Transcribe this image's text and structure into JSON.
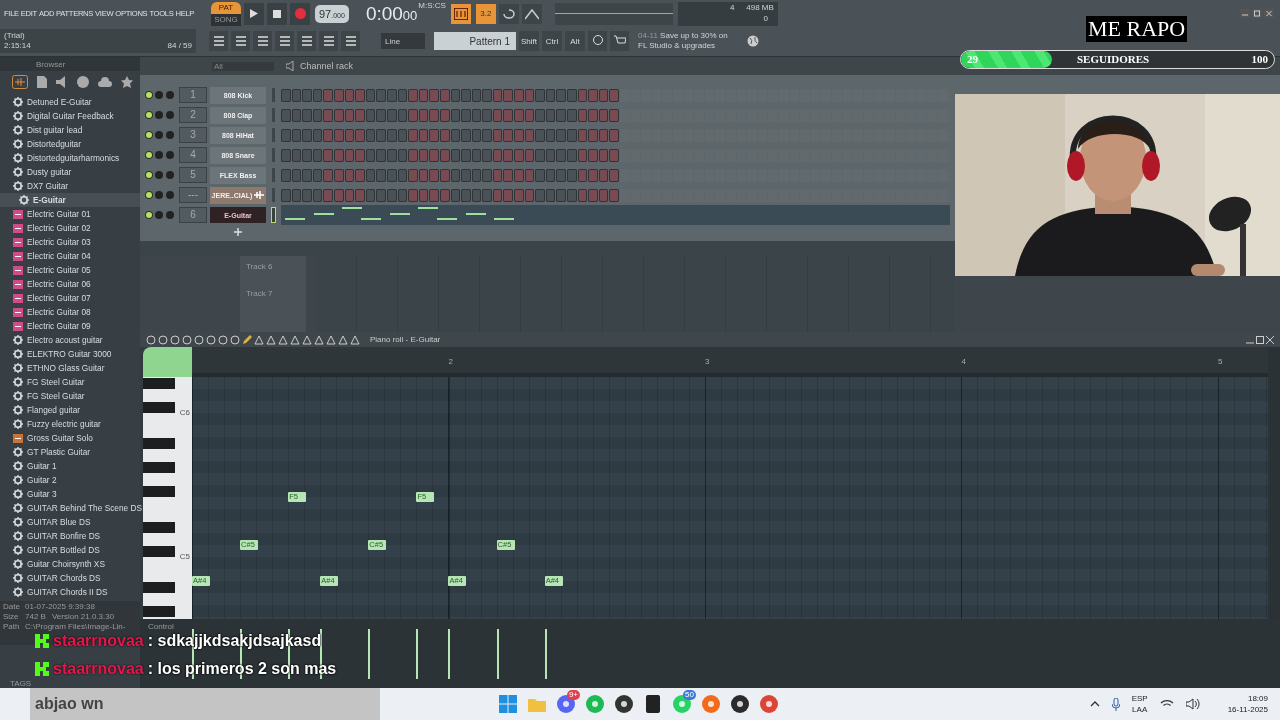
{
  "menu": [
    "FILE",
    "EDIT",
    "ADD",
    "PATTERNS",
    "VIEW",
    "OPTIONS",
    "TOOLS",
    "HELP"
  ],
  "transport": {
    "modes": [
      {
        "label": "PAT",
        "selected": true
      },
      {
        "label": "SONG",
        "selected": false
      }
    ],
    "recording": true,
    "tempo": "97",
    "tempo_fraction": ".000",
    "time": "0:00",
    "time_small": "00",
    "time_unit": "M:S:CS",
    "cpu": "4",
    "memory": "498 MB",
    "voices": "0",
    "toggles": [
      {
        "label": "3.2",
        "on": true
      }
    ]
  },
  "hint": {
    "title": "(Trial)",
    "time": "2:15:14",
    "counter": "84 / 59"
  },
  "snap": "Line",
  "pattern": "Pattern 1",
  "keys": [
    "Shift",
    "Ctrl",
    "Alt"
  ],
  "news": {
    "date": "04-11",
    "text": "Save up to 30% on FL Studio & upgrades"
  },
  "browser": {
    "title": "Browser",
    "items": [
      {
        "label": "Detuned E-Guitar",
        "kind": "preset",
        "selected": false
      },
      {
        "label": "Digital Guitar Feedback",
        "kind": "preset",
        "selected": false
      },
      {
        "label": "Dist guitar lead",
        "kind": "preset",
        "selected": false
      },
      {
        "label": "Distortedguitar",
        "kind": "preset",
        "selected": false
      },
      {
        "label": "Distortedguitarharmonics",
        "kind": "preset",
        "selected": false
      },
      {
        "label": "Dusty guitar",
        "kind": "preset",
        "selected": false
      },
      {
        "label": "DX7 Guitar",
        "kind": "preset",
        "selected": false
      },
      {
        "label": "E-Guitar",
        "kind": "preset",
        "selected": true
      },
      {
        "label": "Electric Guitar 01",
        "kind": "audio",
        "selected": false
      },
      {
        "label": "Electric Guitar 02",
        "kind": "audio",
        "selected": false
      },
      {
        "label": "Electric Guitar 03",
        "kind": "audio",
        "selected": false
      },
      {
        "label": "Electric Guitar 04",
        "kind": "audio",
        "selected": false
      },
      {
        "label": "Electric Guitar 05",
        "kind": "audio",
        "selected": false
      },
      {
        "label": "Electric Guitar 06",
        "kind": "audio",
        "selected": false
      },
      {
        "label": "Electric Guitar 07",
        "kind": "audio",
        "selected": false
      },
      {
        "label": "Electric Guitar 08",
        "kind": "audio",
        "selected": false
      },
      {
        "label": "Electric Guitar 09",
        "kind": "audio",
        "selected": false
      },
      {
        "label": "Electro acoust guitar",
        "kind": "preset",
        "selected": false
      },
      {
        "label": "ELEKTRO Guitar 3000",
        "kind": "preset",
        "selected": false
      },
      {
        "label": "ETHNO Glass Guitar",
        "kind": "preset",
        "selected": false
      },
      {
        "label": "FG Steel Guitar",
        "kind": "preset",
        "selected": false
      },
      {
        "label": "FG Steel Guitar",
        "kind": "preset",
        "selected": false
      },
      {
        "label": "Flanged guitar",
        "kind": "preset",
        "selected": false
      },
      {
        "label": "Fuzzy electric guitar",
        "kind": "preset",
        "selected": false
      },
      {
        "label": "Gross Guitar Solo",
        "kind": "ogg",
        "selected": false
      },
      {
        "label": "GT Plastic Guitar",
        "kind": "preset",
        "selected": false
      },
      {
        "label": "Guitar 1",
        "kind": "preset",
        "selected": false
      },
      {
        "label": "Guitar 2",
        "kind": "preset",
        "selected": false
      },
      {
        "label": "Guitar 3",
        "kind": "preset",
        "selected": false
      },
      {
        "label": "GUITAR Behind The Scene DS",
        "kind": "preset",
        "selected": false
      },
      {
        "label": "GUITAR Blue DS",
        "kind": "preset",
        "selected": false
      },
      {
        "label": "GUITAR Bonfire DS",
        "kind": "preset",
        "selected": false
      },
      {
        "label": "GUITAR Bottled DS",
        "kind": "preset",
        "selected": false
      },
      {
        "label": "Guitar Choirsynth XS",
        "kind": "preset",
        "selected": false
      },
      {
        "label": "GUITAR Chords DS",
        "kind": "preset",
        "selected": false
      },
      {
        "label": "GUITAR Chords II DS",
        "kind": "preset",
        "selected": false
      }
    ],
    "info": {
      "date_label": "Date",
      "date": "01-07-2025 9:39:38",
      "size_label": "Size",
      "size": "742 B",
      "version": "Version 21.0.3.30",
      "path_label": "Path",
      "path": "C:\\Program Files\\Image-Lin-"
    },
    "tags_label": "TAGS"
  },
  "channel_rack": {
    "filter": "All",
    "title": "Channel rack",
    "channels": [
      {
        "number": "1",
        "name": "808 Kick",
        "kind": "steps",
        "selected": false
      },
      {
        "number": "2",
        "name": "808 Clap",
        "kind": "steps",
        "selected": false
      },
      {
        "number": "3",
        "name": "808 HiHat",
        "kind": "steps",
        "selected": false
      },
      {
        "number": "4",
        "name": "808 Snare",
        "kind": "steps",
        "selected": false
      },
      {
        "number": "5",
        "name": "FLEX Bass",
        "kind": "steps",
        "selected": false
      },
      {
        "number": "---",
        "name": "JERE..CIAL)",
        "kind": "plugin",
        "selected": false
      },
      {
        "number": "6",
        "name": "E-Guitar",
        "kind": "notes",
        "selected": true
      }
    ]
  },
  "playlist": {
    "tracks": [
      "Track 6",
      "Track 7"
    ]
  },
  "piano_roll": {
    "title": "Piano roll - E-Guitar",
    "bars": [
      "2",
      "3",
      "4",
      "5"
    ],
    "key_labels": [
      "C6",
      "C5"
    ],
    "notes": [
      {
        "label": "A#4"
      },
      {
        "label": "C#5"
      },
      {
        "label": "F5"
      },
      {
        "label": "A#4"
      },
      {
        "label": "C#5"
      },
      {
        "label": "F5"
      },
      {
        "label": "A#4"
      },
      {
        "label": "C#5"
      },
      {
        "label": "A#4"
      }
    ],
    "control_label": "Control"
  },
  "overlay": {
    "title": "ME RAPO",
    "goal": {
      "current": "29",
      "label": "SEGUIDORES",
      "target": "100",
      "level": 0.29
    },
    "chat": [
      {
        "user": "staarrnovaa",
        "text": ": sdkajjkdsakjdsajkasd"
      },
      {
        "user": "staarrnovaa",
        "text": ": los primeros 2 son mas"
      }
    ],
    "chat_continuation": "abjao wn"
  },
  "taskbar": {
    "apps": [
      {
        "kind": "windows"
      },
      {
        "kind": "folder"
      },
      {
        "kind": "discord",
        "badge": "9+"
      },
      {
        "kind": "spotify"
      },
      {
        "kind": "fl"
      },
      {
        "kind": "epic"
      },
      {
        "kind": "whatsapp",
        "badge": "50"
      },
      {
        "kind": "bars"
      },
      {
        "kind": "obs"
      },
      {
        "kind": "chrome"
      }
    ],
    "language": "ESP",
    "layout": "LAA",
    "time": "18:09",
    "date": "16-11-2025"
  }
}
